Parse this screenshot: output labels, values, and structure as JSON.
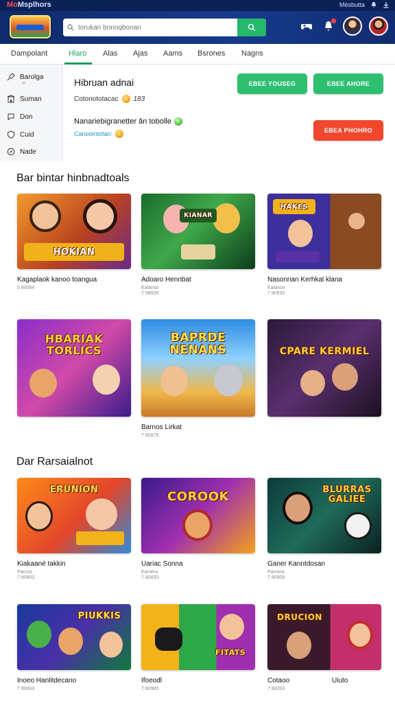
{
  "app": {
    "brand_prefix": "Mo",
    "brand_rest": "Msplhors",
    "status_text": "Mésbutta"
  },
  "search": {
    "placeholder": "torukan bonoqbonan"
  },
  "tabs": [
    {
      "label": "Dampolant"
    },
    {
      "label": "Hlaro"
    },
    {
      "label": "Alas"
    },
    {
      "label": "Ajas"
    },
    {
      "label": "Aams"
    },
    {
      "label": "Bsrones"
    },
    {
      "label": "Nagns"
    }
  ],
  "sidebar": {
    "items": [
      {
        "label": "Barolga",
        "icon": "pin-icon"
      },
      {
        "label": "Suman",
        "icon": "building-icon"
      },
      {
        "label": "Don",
        "icon": "chat-icon"
      },
      {
        "label": "Cuid",
        "icon": "shield-icon"
      },
      {
        "label": "Nade",
        "icon": "compass-icon"
      }
    ],
    "sub_label": "ˣᵒ"
  },
  "promo": {
    "title": "Hibruan adnai",
    "subtitle": "Cotonototacac",
    "subtitle_value": "183",
    "line": "Nanariebigranetter ân tobolle",
    "link": "Canoointotan:",
    "buttons": {
      "primary": "EBEE YOUSEG",
      "secondary": "EBEE AHORE",
      "danger": "EBEA PHOHRO"
    }
  },
  "sections": [
    {
      "title": "Bar bintar hinbnadtoals",
      "cards": [
        {
          "art": "HOKIAN",
          "title": "Kagaplaok kanoo toangua",
          "meta": "5 80094",
          "meta2": ""
        },
        {
          "art": "KIANAR",
          "title": "Adoaro Hennbat",
          "meta": "Ealanso",
          "meta2": "7 08935"
        },
        {
          "art": "HAKES",
          "title": "Nasonrian Kerhkal klana",
          "meta": "Ealance",
          "meta2": "7 80935"
        },
        {
          "art": "HBARIAK TORLICS",
          "title": "",
          "meta": "",
          "meta2": ""
        },
        {
          "art": "BAPRDE NENANS",
          "title": "Barnos Lirkat",
          "meta": "7 80975",
          "meta2": ""
        },
        {
          "art": "CPARE KERMIEL",
          "title": "",
          "meta": "",
          "meta2": ""
        }
      ]
    },
    {
      "title": "Dar Rarsaialnot",
      "cards": [
        {
          "art": "ERUNION",
          "title": "Kiakaané takkin",
          "meta": "Parcos",
          "meta2": "7 80903"
        },
        {
          "art": "COROOK",
          "title": "Uariac Sonna",
          "meta": "Eaniera",
          "meta2": "7 80833"
        },
        {
          "art": "BLURRAS GALIEE",
          "title": "Ganer Kanntdosan",
          "meta": "Parnora",
          "meta2": "7 80908"
        },
        {
          "art": "PIUKKIS",
          "title": "Inoeo Hanlitdecano",
          "meta": "7 80003",
          "meta2": ""
        },
        {
          "art": "FITATS",
          "title": "Ifoeodl",
          "meta": "7 80985",
          "meta2": ""
        },
        {
          "art": "DRUCION",
          "title": "Cotaoo",
          "meta": "7 80203",
          "meta2": "",
          "extra": "Uiuto"
        }
      ]
    }
  ]
}
